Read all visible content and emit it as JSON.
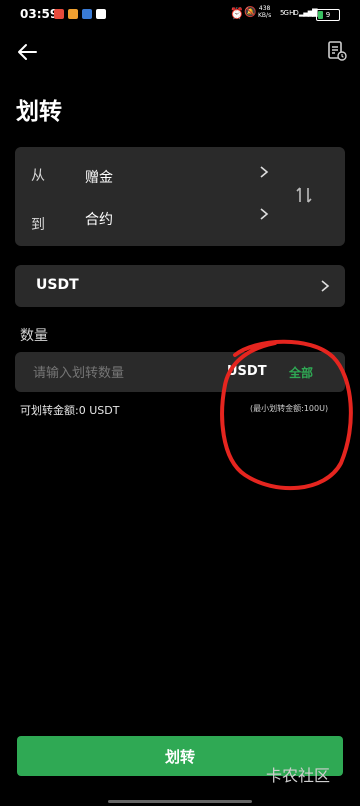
{
  "status_bar": {
    "time": "03:59",
    "net_speed": "438",
    "net_unit": "KB/s",
    "sim1": "5G HD",
    "sim2": "5G HD",
    "battery": "9"
  },
  "header": {
    "back_icon": "arrow-left-icon",
    "records_icon": "record-clock-icon"
  },
  "page": {
    "title": "划转"
  },
  "transfer": {
    "from_label": "从",
    "from_value": "赠金",
    "to_label": "到",
    "to_value": "合约",
    "swap_icon": "swap-vertical-icon"
  },
  "asset": {
    "coin": "USDT"
  },
  "amount": {
    "label": "数量",
    "placeholder": "请输入划转数量",
    "unit": "USDT",
    "all_label": "全部",
    "available": "可划转金额:0 USDT",
    "min": "(最小划转金额:100U)"
  },
  "actions": {
    "submit": "划转"
  },
  "watermark": "卡农社区",
  "colors": {
    "accent": "#2fa954",
    "annotation": "#e5251f"
  }
}
